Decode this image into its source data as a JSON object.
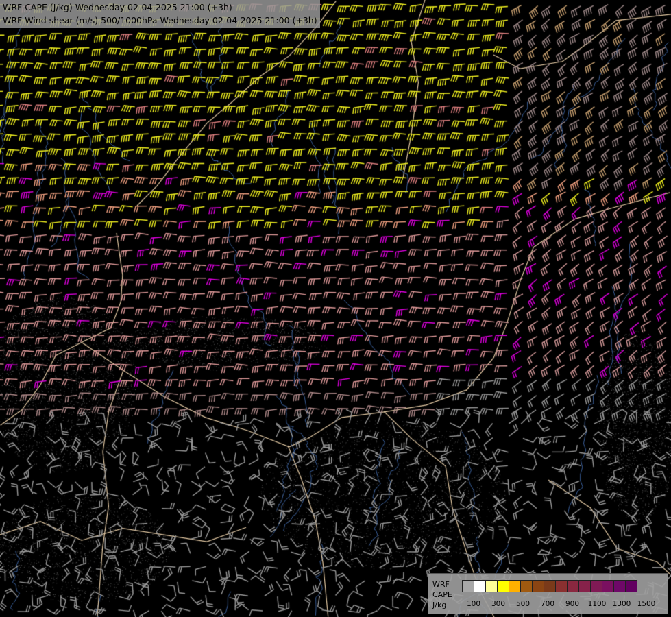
{
  "title": {
    "line1": "WRF CAPE (J/kg) Wednesday 02-04-2025 21:00 (+3h)",
    "line2": "WRF Wind shear (m/s) 500/1000hPa Wednesday 02-04-2025 21:00 (+3h)"
  },
  "legend": {
    "name_lines": [
      "WRF",
      "CAPE",
      "J/kg"
    ],
    "colors": [
      "#a8a8a8",
      "#ffffff",
      "#ffff99",
      "#ffff00",
      "#ffb000",
      "#a05a10",
      "#8b4513",
      "#7a3a1a",
      "#8a3030",
      "#8a2840",
      "#86224a",
      "#801a55",
      "#7a1060",
      "#6e0868",
      "#620060"
    ],
    "ticks": [
      "100",
      "300",
      "500",
      "700",
      "900",
      "1100",
      "1300",
      "1500"
    ]
  }
}
